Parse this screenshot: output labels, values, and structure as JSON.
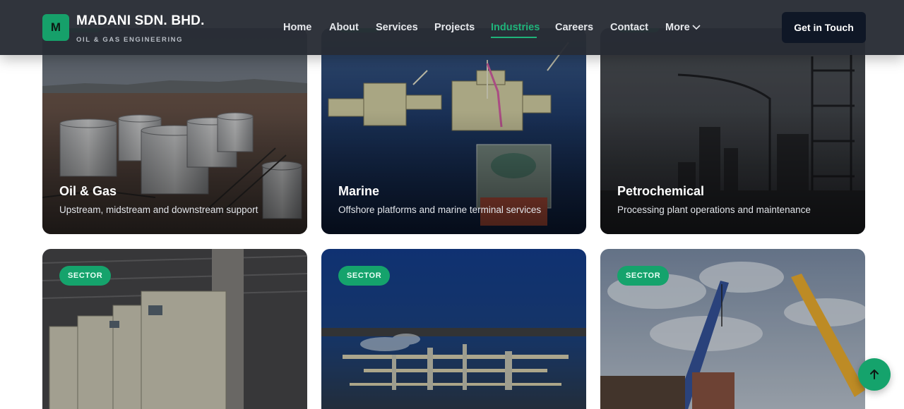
{
  "brand": {
    "logo_letter": "M",
    "name": "MADANI SDN. BHD.",
    "tagline": "OIL & GAS ENGINEERING"
  },
  "nav": {
    "items": [
      {
        "label": "Home"
      },
      {
        "label": "About"
      },
      {
        "label": "Services"
      },
      {
        "label": "Projects"
      },
      {
        "label": "Industries",
        "active": true
      },
      {
        "label": "Careers"
      },
      {
        "label": "Contact"
      },
      {
        "label": "More"
      }
    ],
    "cta_label": "Get in Touch"
  },
  "industries": [
    {
      "title": "Oil & Gas",
      "description": "Upstream, midstream and downstream support"
    },
    {
      "title": "Marine",
      "description": "Offshore platforms and marine terminal services"
    },
    {
      "title": "Petrochemical",
      "description": "Processing plant operations and maintenance"
    },
    {
      "badge": "SECTOR"
    },
    {
      "badge": "SECTOR"
    },
    {
      "badge": "SECTOR"
    }
  ],
  "icons": {
    "more": "chevron-down-icon",
    "scroll_top": "arrow-up-icon"
  },
  "colors": {
    "accent": "#15a36c",
    "nav_bg": "#282c34",
    "cta_bg": "#0f1726"
  }
}
